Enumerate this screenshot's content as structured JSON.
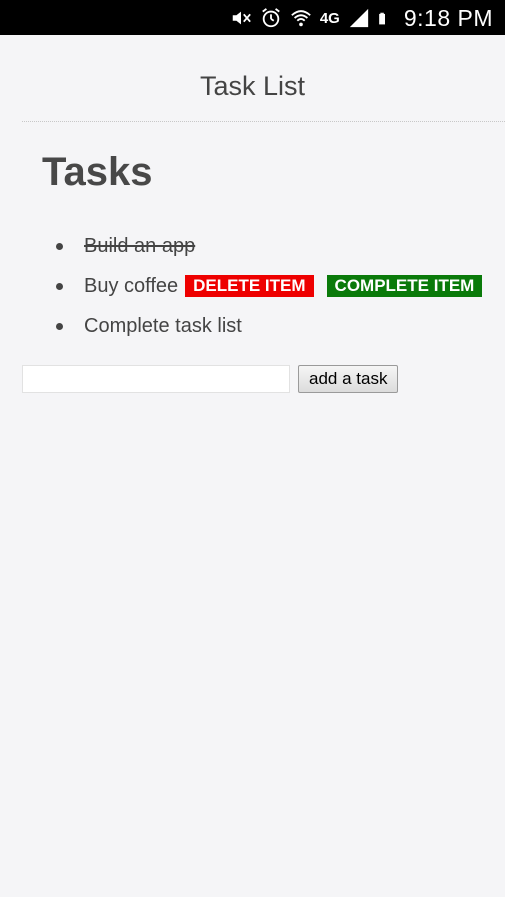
{
  "status_bar": {
    "time": "9:18 PM",
    "network_label": "4G",
    "icons": [
      "mute-icon",
      "alarm-icon",
      "wifi-icon",
      "lte-icon",
      "signal-icon",
      "battery-icon"
    ]
  },
  "header": {
    "title": "Task List"
  },
  "main": {
    "heading": "Tasks",
    "tasks": [
      {
        "label": "Build an app",
        "completed": true
      },
      {
        "label": "Buy coffee",
        "completed": false,
        "delete_label": "DELETE ITEM",
        "complete_label": "COMPLETE ITEM"
      },
      {
        "label": "Complete task list",
        "completed": false
      }
    ],
    "new_task": {
      "value": "",
      "placeholder": "",
      "button_label": "add a task"
    }
  },
  "colors": {
    "delete": "#ee0000",
    "complete": "#0a7a0a",
    "background": "#f5f5f7",
    "status_bar": "#000000"
  }
}
